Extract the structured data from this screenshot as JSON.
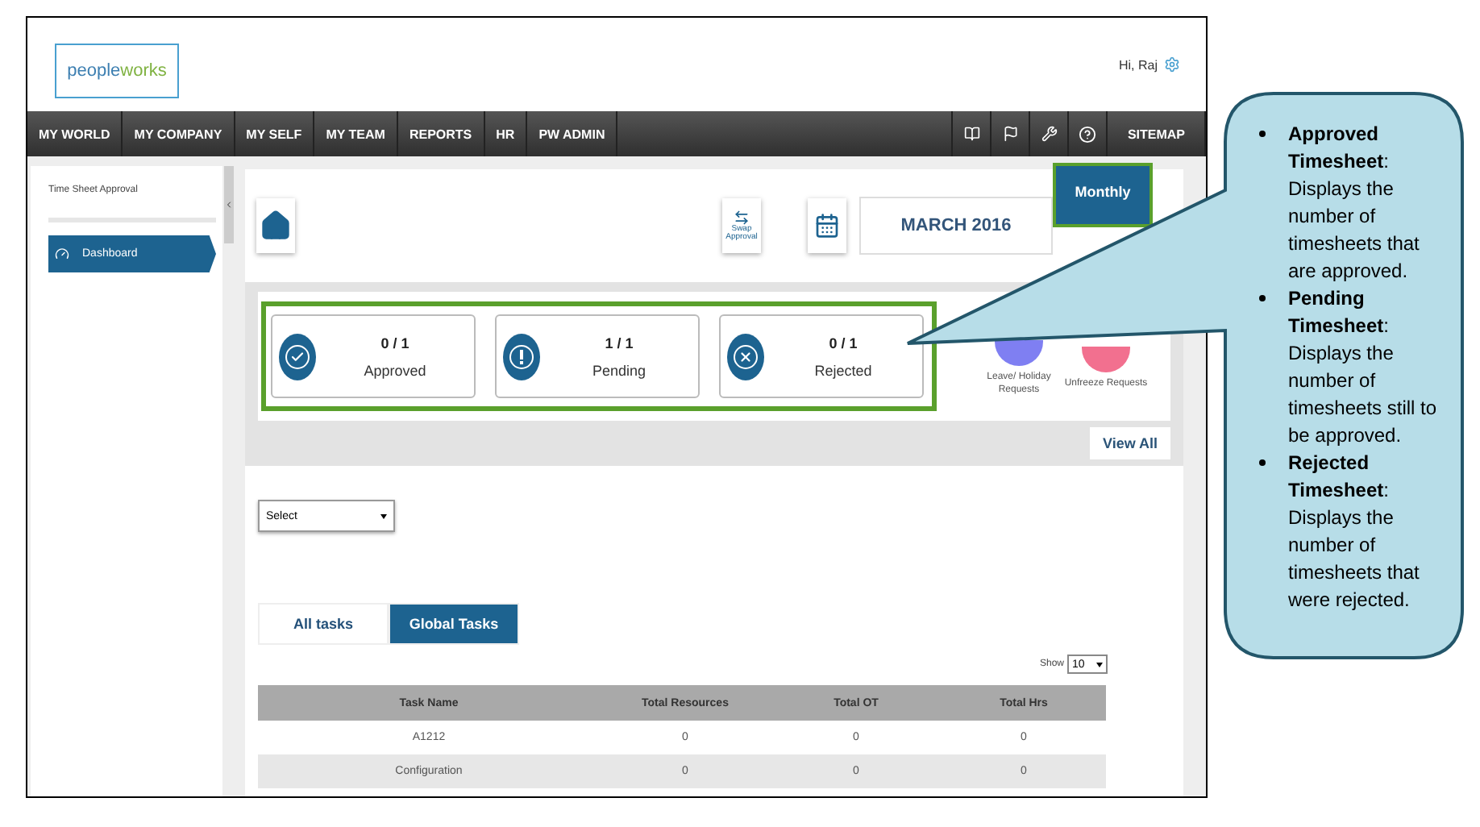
{
  "header": {
    "logo": [
      "pe",
      "o",
      "ple",
      "works"
    ],
    "greeting": "Hi, Raj"
  },
  "nav": {
    "items": [
      "MY WORLD",
      "MY COMPANY",
      "MY SELF",
      "MY TEAM",
      "REPORTS",
      "HR",
      "PW ADMIN"
    ],
    "sitemap": "SITEMAP"
  },
  "sidebar": {
    "title": "Time Sheet Approval",
    "items": [
      {
        "label": "Dashboard",
        "selected": true
      }
    ]
  },
  "toolbar": {
    "swap": "Swap Approval",
    "month": "MARCH 2016",
    "view": "Monthly"
  },
  "stats": [
    {
      "kind": "approved",
      "value": "0 / 1",
      "label": "Approved"
    },
    {
      "kind": "pending",
      "value": "1 / 1",
      "label": "Pending"
    },
    {
      "kind": "rejected",
      "value": "0 / 1",
      "label": "Rejected"
    }
  ],
  "requests": [
    {
      "label": "Leave/ Holiday Requests",
      "color": "#7f7ff2"
    },
    {
      "label": "Unfreeze Requests",
      "color": "#f2708f"
    }
  ],
  "view_all": "View All",
  "filter": {
    "value": "Select"
  },
  "tabs": [
    {
      "label": "All tasks",
      "selected": false
    },
    {
      "label": "Global Tasks",
      "selected": true
    }
  ],
  "show": {
    "label": "Show",
    "value": "10"
  },
  "table": {
    "columns": [
      "Task Name",
      "Total Resources",
      "Total OT",
      "Total Hrs"
    ],
    "rows": [
      [
        "A1212",
        "0",
        "0",
        "0"
      ],
      [
        "Configuration",
        "0",
        "0",
        "0"
      ]
    ]
  },
  "callout": {
    "items": [
      "**Approved Timesheet**: Displays the number of timesheets that are approved.",
      "**Pending Timesheet**: Displays the number of timesheets still to be approved.",
      "**Rejected Timesheet**: Displays the number of timesheets that were rejected."
    ]
  }
}
